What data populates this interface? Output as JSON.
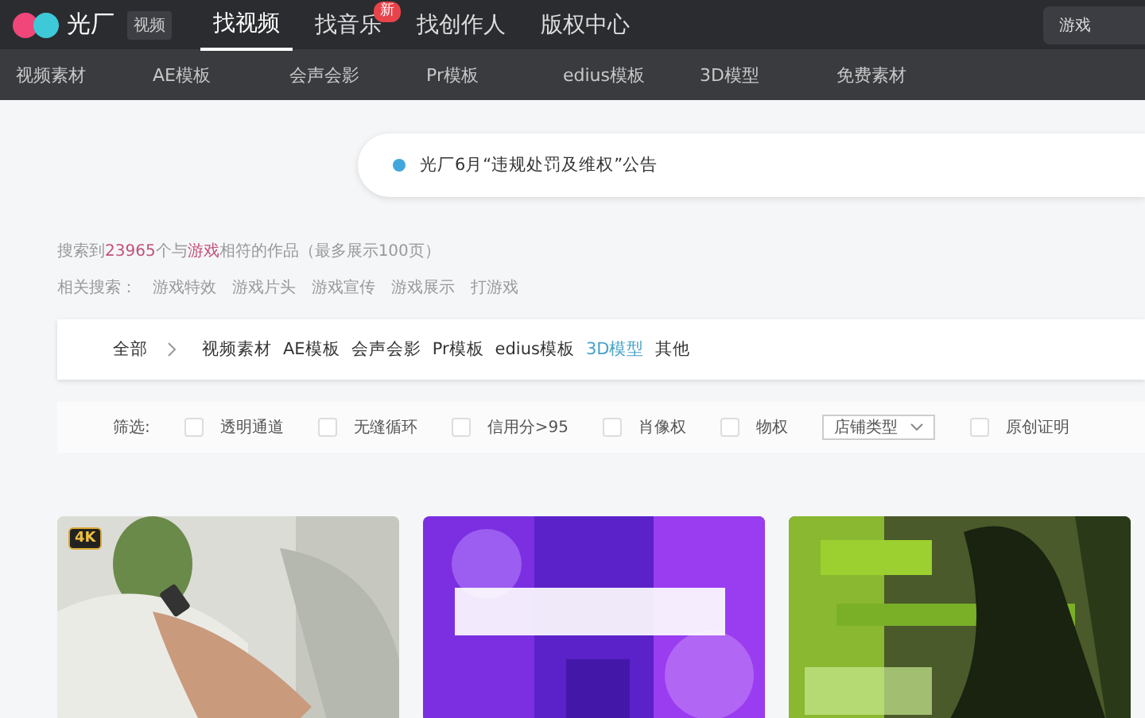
{
  "header": {
    "logo_text": "光厂",
    "logo_badge": "视频",
    "nav": [
      {
        "label": "找视频",
        "selected": true
      },
      {
        "label": "找音乐",
        "selected": false,
        "badge": "新"
      },
      {
        "label": "找创作人",
        "selected": false
      },
      {
        "label": "版权中心",
        "selected": false
      }
    ],
    "search": {
      "value": "游戏"
    }
  },
  "subnav": [
    "视频素材",
    "AE模板",
    "会声会影",
    "Pr模板",
    "edius模板",
    "3D模型",
    "免费素材"
  ],
  "notice": {
    "text": "光厂6月“违规处罚及维权”公告"
  },
  "summary": {
    "prefix": "搜索到",
    "count": "23965",
    "middle": "个与",
    "keyword": "游戏",
    "suffix": "相符的作品（最多展示100页）"
  },
  "related": {
    "label": "相关搜索：",
    "items": [
      "游戏特效",
      "游戏片头",
      "游戏宣传",
      "游戏展示",
      "打游戏"
    ]
  },
  "categories": {
    "all": "全部",
    "items": [
      {
        "label": "视频素材",
        "selected": false
      },
      {
        "label": "AE模板",
        "selected": false
      },
      {
        "label": "会声会影",
        "selected": false
      },
      {
        "label": "Pr模板",
        "selected": false
      },
      {
        "label": "edius模板",
        "selected": false
      },
      {
        "label": "3D模型",
        "selected": true
      },
      {
        "label": "其他",
        "selected": false
      }
    ]
  },
  "filters": {
    "label": "筛选:",
    "items": [
      {
        "kind": "checkbox",
        "label": "透明通道",
        "checked": false
      },
      {
        "kind": "checkbox",
        "label": "无缝循环",
        "checked": false
      },
      {
        "kind": "checkbox",
        "label": "信用分>95",
        "checked": false
      },
      {
        "kind": "checkbox",
        "label": "肖像权",
        "checked": false
      },
      {
        "kind": "checkbox",
        "label": "物权",
        "checked": false
      },
      {
        "kind": "dropdown",
        "label": "店铺类型"
      },
      {
        "kind": "checkbox",
        "label": "原创证明",
        "checked": false
      }
    ]
  },
  "cards": [
    {
      "kind": "picture",
      "badge": "4K"
    },
    {
      "kind": "picture"
    },
    {
      "kind": "picture"
    }
  ]
}
